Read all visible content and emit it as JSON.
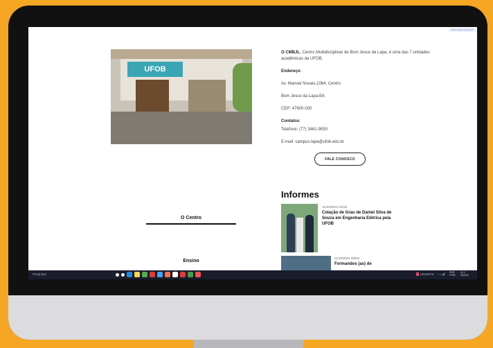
{
  "screen": {
    "top_link": "Adam Borges Rodrigues"
  },
  "photo": {
    "sign_text": "UFOB"
  },
  "info": {
    "intro_bold": "O CMBJL",
    "intro_rest": ", Centro Multidisciplinar de Bom Jesus da Lapa, é uma das 7 unidades acadêmicas da UFOB.",
    "address_label": "Endereço:",
    "address_line1": "Av. Manoel Novais,1064, Centro",
    "address_line2": "Bom Jesus da Lapa-BA",
    "cep": "CEP: 47600-000",
    "contacts_label": "Contatos:",
    "phone": "Telefone: (77) 3481-9050",
    "email": "E-mail: campus.lapa@ufob.edu.br",
    "contact_button": "FALE CONOSCO"
  },
  "sections": {
    "centro": "O Centro",
    "ensino": "Ensino"
  },
  "informes": {
    "title": "Informes",
    "items": [
      {
        "date": "11/10/2024 14h18",
        "title": "Colação de Grau de Daniel Silva de Souza em Engenharia Elétrica pela UFOB"
      },
      {
        "date": "21/10/2024 09h32",
        "title": "Formandos (as) de"
      }
    ]
  },
  "taskbar": {
    "search_placeholder": "Pesquisar",
    "icon_colors": [
      "#ffffff",
      "#ffffff",
      "#1e88e5",
      "#ffd54f",
      "#4caf50",
      "#e53935",
      "#42a5f5",
      "#ff7043",
      "#ffffff",
      "#e53935",
      "#43a047",
      "#ef5350"
    ],
    "status_label": "URGENTE",
    "tray_text": "^ ⌂ 🔊",
    "time_line1": "POR",
    "time_line2": "PTB2",
    "clock_line1": "11:1",
    "clock_line2": "30/10/2"
  },
  "colors": {
    "background": "#f5a623",
    "monitor": "#111111",
    "taskbar": "#1a1d2b",
    "sign": "#3aa6b5"
  }
}
